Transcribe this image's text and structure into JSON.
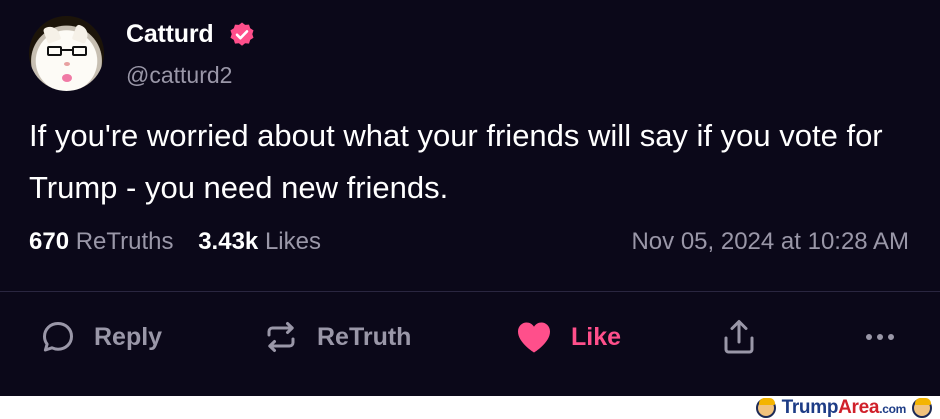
{
  "post": {
    "display_name": "Catturd",
    "handle": "@catturd2",
    "verified_icon": "verified-badge",
    "text": "If you're worried about what your friends will say if you vote for Trump - you need new friends.",
    "stats": {
      "retruths_count": "670",
      "retruths_label": "ReTruths",
      "likes_count": "3.43k",
      "likes_label": "Likes"
    },
    "timestamp": "Nov 05, 2024 at 10:28 AM"
  },
  "actions": {
    "reply_label": "Reply",
    "retruth_label": "ReTruth",
    "like_label": "Like",
    "share_icon": "share-icon",
    "more_icon": "more-icon"
  },
  "watermark": {
    "brand_part1": "Trump",
    "brand_part2": "Area",
    "brand_suffix": ".com"
  },
  "colors": {
    "background": "#0b0819",
    "muted_text": "#9a97a8",
    "like_accent": "#ff4f8b",
    "verified": "#ff4f8b"
  }
}
